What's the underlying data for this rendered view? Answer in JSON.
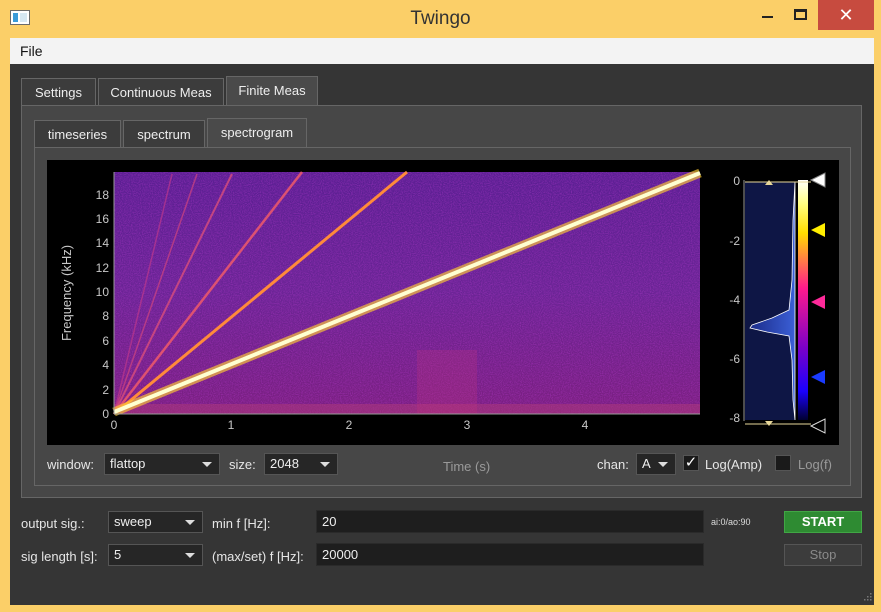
{
  "window": {
    "title": "Twingo"
  },
  "menu": {
    "file": "File"
  },
  "main_tabs": [
    "Settings",
    "Continuous Meas",
    "Finite Meas"
  ],
  "sub_tabs": [
    "timeseries",
    "spectrum",
    "spectrogram"
  ],
  "plot": {
    "y_axis_label": "Frequency (kHz)",
    "x_axis_label": "Time (s)",
    "y_ticks": [
      "0",
      "2",
      "4",
      "6",
      "8",
      "10",
      "12",
      "14",
      "16",
      "18"
    ],
    "x_ticks": [
      "0",
      "1",
      "2",
      "3",
      "4"
    ],
    "colorbar_ticks": [
      "0",
      "-2",
      "-4",
      "-6",
      "-8"
    ]
  },
  "spectro_controls": {
    "window_label": "window:",
    "window_value": "flattop",
    "size_label": "size:",
    "size_value": "2048",
    "chan_label": "chan:",
    "chan_value": "A",
    "log_amp_label": "Log(Amp)",
    "log_amp_check": "✓",
    "log_f_label": "Log(f)"
  },
  "bottom": {
    "output_sig_label": "output sig.:",
    "output_sig_value": "sweep",
    "sig_length_label": "sig length [s]:",
    "sig_length_value": "5",
    "min_f_label": "min f [Hz]:",
    "min_f_value": "20",
    "max_f_label": "(max/set) f [Hz]:",
    "max_f_value": "20000",
    "io_status": "ai:0/ao:90",
    "start_label": "START",
    "stop_label": "Stop"
  },
  "colors": {
    "start_green": "#2e8b32",
    "title_bar": "#fbcf68",
    "close_red": "#c74b3f"
  }
}
